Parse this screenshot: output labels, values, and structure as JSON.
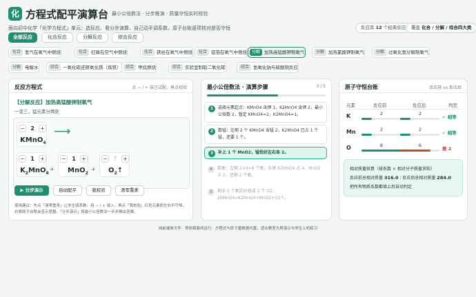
{
  "app": {
    "logo_char": "化",
    "title": "方程式配平演算台",
    "tagline": "最小公倍数法 · 分步推演 · 质量守恒实时校验",
    "subtitle": "面向初中化学「化学方程式」单元：选反应、看分步演算、自己动手调系数，原子台账逐项核对是否守恒",
    "library_pill_prefix": "反应库",
    "library_count": "12",
    "library_pill_suffix": "个经典反应",
    "coverage_pill_prefix": "覆盖",
    "coverage_pill_value": "化合 / 分解 / 综合四大类"
  },
  "filters": [
    "全部反应",
    "化合反应",
    "分解反应",
    "综合反应"
  ],
  "chips": [
    {
      "tag": "化合",
      "label": "氢气在氧气中燃烧"
    },
    {
      "tag": "化合",
      "label": "红磷在空气中燃烧"
    },
    {
      "tag": "化合",
      "label": "铁丝在氧气中燃烧"
    },
    {
      "tag": "化合",
      "label": "铝箔在氧气中燃烧"
    },
    {
      "tag": "分解",
      "label": "加热高锰酸钾制氧气"
    },
    {
      "tag": "分解",
      "label": "加热氯酸钾制氧气"
    },
    {
      "tag": "分解",
      "label": "过氧化氢分解制氧气"
    },
    {
      "tag": "分解",
      "label": "电解水"
    },
    {
      "tag": "综合",
      "label": "一氧化碳还原氧化铁（炼铁）"
    },
    {
      "tag": "综合",
      "label": "甲烷燃烧"
    },
    {
      "tag": "综合",
      "label": "实验室制取二氧化碳"
    },
    {
      "tag": "综合",
      "label": "氢氧化钠与硫酸铜反应"
    }
  ],
  "equation_panel": {
    "title": "反应方程式",
    "hint": "点 − / + 自己试配，再点校验",
    "reaction_name": "【分解反应】加热高锰酸钾制氧气",
    "reaction_desc": "一变三，猛元素分两处",
    "reactant": {
      "coef": "2",
      "formula": "KMnO",
      "sub": "4"
    },
    "products": [
      {
        "coef": "1",
        "pre": "K",
        "s1": "2",
        "mid": "MnO",
        "s2": "4",
        "arrow": ""
      },
      {
        "coef": "1",
        "pre": "MnO",
        "s1": "2",
        "mid": "",
        "s2": "",
        "arrow": ""
      },
      {
        "coef": "?",
        "pre": "O",
        "s1": "2",
        "mid": "",
        "s2": "",
        "arrow": "↑"
      }
    ],
    "minus": "−",
    "plus": "+",
    "yields_arrow": "⟶",
    "buttons": {
      "demo": "分步演示",
      "auto": "自动配平",
      "check": "我校验",
      "reset": "清零重来"
    },
    "usage_note": "使用建议：先点「清零重来」让学生填系数，用 − / + 填入，再点「我校验」红色元素即左右不守恒，右侧原子台账会显示差额。「分步演示」按最小公倍数法一步步推出答案。"
  },
  "steps_panel": {
    "title": "最小公倍数法 · 演算步骤",
    "counter": "3 / 5",
    "progress": 0.6,
    "steps": [
      {
        "num": "1",
        "state": "done",
        "text": "选择元素起点：KMnO4 含钾 1，K2MnO4 含钾 2，最小公倍数 2，暂定 KMnO4=2，K2MnO4=1。"
      },
      {
        "num": "2",
        "state": "done",
        "text": "数锰：左侧 2 个 KMnO4 含锰 2，K2MnO4 已占 1 个锰，还要 1 个。"
      },
      {
        "num": "3",
        "state": "current",
        "text": "补上 1 个 MnO2，锰恰好左右各 2。"
      },
      {
        "num": "4",
        "state": "pending",
        "text": "数氧：左侧 2×4=8 个氧；右侧 K2MnO4 占 4、MnO2 占 2，还剩 2 个氧。"
      },
      {
        "num": "5",
        "state": "pending",
        "text": "剩余 2 个氧正好组成 1 个 O2，2KMnO4=K2MnO4+MnO2+O2↑。"
      }
    ]
  },
  "ledger_panel": {
    "title": "原子守恒台账",
    "hint": "反应前 vs 反应后",
    "col_element": "元素",
    "col_before": "反应前",
    "col_after": "反应后",
    "col_verdict": "判定",
    "rows": [
      {
        "el": "K",
        "before": 2,
        "after": 2,
        "verdict": "✓ 相等",
        "ok": true
      },
      {
        "el": "Mn",
        "before": 2,
        "after": 2,
        "verdict": "✓ 相等",
        "ok": true
      },
      {
        "el": "O",
        "before": 8,
        "after": 6,
        "verdict": "差 2",
        "ok": false
      }
    ],
    "bar_max": 8,
    "summary_title": "相对质量核算（按系数 × 相对分子质量求和）",
    "mass_before_label": "反应前总相对质量",
    "mass_before": "316.0",
    "mass_after_label": "反应后总相对质量",
    "mass_after": "284.0",
    "summary_note": "把所有物质系数都填上后自动判定",
    "color_ok": "#1f8f6e",
    "color_bad": "#b5541c"
  },
  "footer": "纯前端单文件 · 零依赖离线运行 · 方程式与原子量数据内置，适合教室大屏演示与学生上机练习"
}
